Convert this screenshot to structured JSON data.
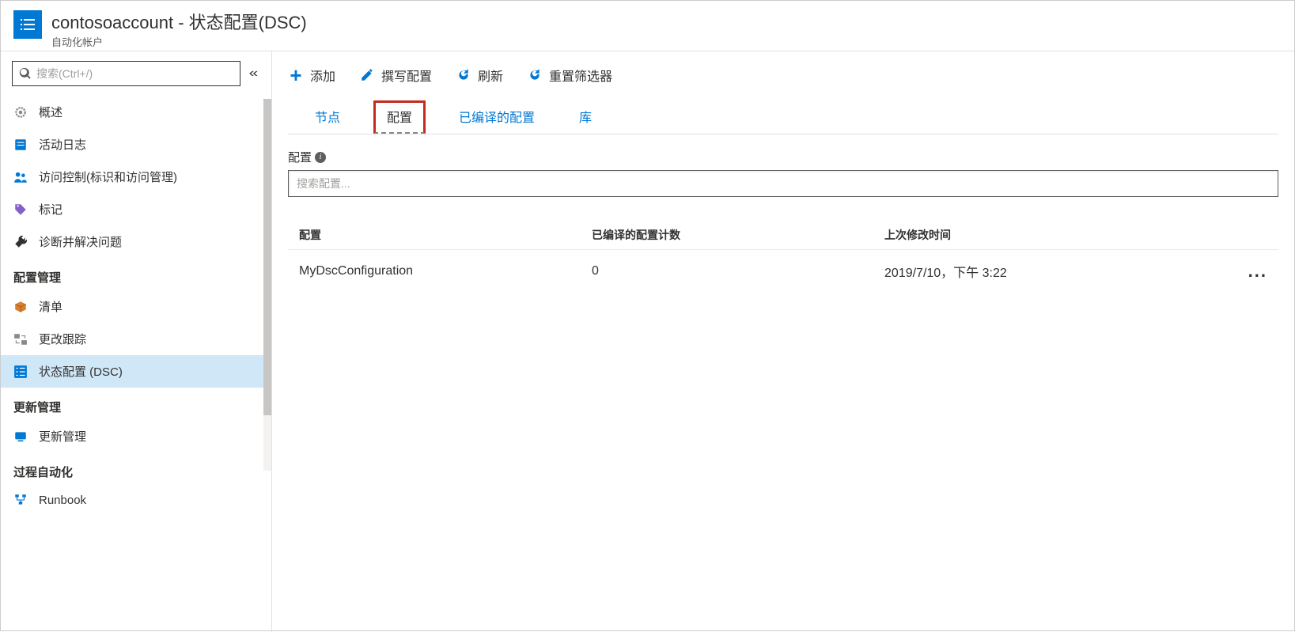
{
  "header": {
    "title": "contosoaccount - 状态配置(DSC)",
    "subtitle": "自动化帐户"
  },
  "sidebar": {
    "search_placeholder": "搜索(Ctrl+/)",
    "items_top": [
      {
        "label": "概述",
        "icon": "gear"
      },
      {
        "label": "活动日志",
        "icon": "log"
      },
      {
        "label": "访问控制(标识和访问管理)",
        "icon": "people"
      },
      {
        "label": "标记",
        "icon": "tag"
      },
      {
        "label": "诊断并解决问题",
        "icon": "wrench"
      }
    ],
    "section_config": "配置管理",
    "items_config": [
      {
        "label": "清单",
        "icon": "box"
      },
      {
        "label": "更改跟踪",
        "icon": "changes"
      },
      {
        "label": "状态配置 (DSC)",
        "icon": "checklist",
        "selected": true
      }
    ],
    "section_update": "更新管理",
    "items_update": [
      {
        "label": "更新管理",
        "icon": "monitor"
      }
    ],
    "section_process": "过程自动化",
    "items_process": [
      {
        "label": "Runbook",
        "icon": "flow"
      }
    ]
  },
  "toolbar": {
    "add": "添加",
    "compose": "撰写配置",
    "refresh": "刷新",
    "reset_filter": "重置筛选器"
  },
  "tabs": {
    "nodes": "节点",
    "config": "配置",
    "compiled": "已编译的配置",
    "library": "库"
  },
  "section": {
    "label": "配置",
    "search_placeholder": "搜索配置..."
  },
  "table": {
    "headers": {
      "config": "配置",
      "compiled_count": "已编译的配置计数",
      "last_modified": "上次修改时间"
    },
    "rows": [
      {
        "config": "MyDscConfiguration",
        "compiled_count": "0",
        "last_modified": "2019/7/10，下午 3:22"
      }
    ]
  }
}
